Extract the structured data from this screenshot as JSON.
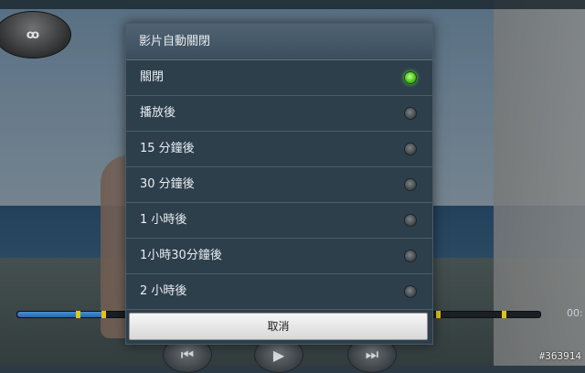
{
  "dialog": {
    "title": "影片自動關閉",
    "options": [
      {
        "label": "關閉",
        "selected": true
      },
      {
        "label": "播放後",
        "selected": false
      },
      {
        "label": "15 分鐘後",
        "selected": false
      },
      {
        "label": "30 分鐘後",
        "selected": false
      },
      {
        "label": "1 小時後",
        "selected": false
      },
      {
        "label": "1小時30分鐘後",
        "selected": false
      },
      {
        "label": "2 小時後",
        "selected": false
      }
    ],
    "cancel_label": "取消"
  },
  "player": {
    "mode_label": "ꝏ",
    "time_right": "00:",
    "controls": {
      "prev_icon": "rewind-icon",
      "play_icon": "play-icon",
      "next_icon": "fast-forward-icon"
    }
  },
  "watermark": "#363914",
  "colors": {
    "accent_selected": "#44c21a",
    "dialog_bg": "#2e3f4c"
  }
}
